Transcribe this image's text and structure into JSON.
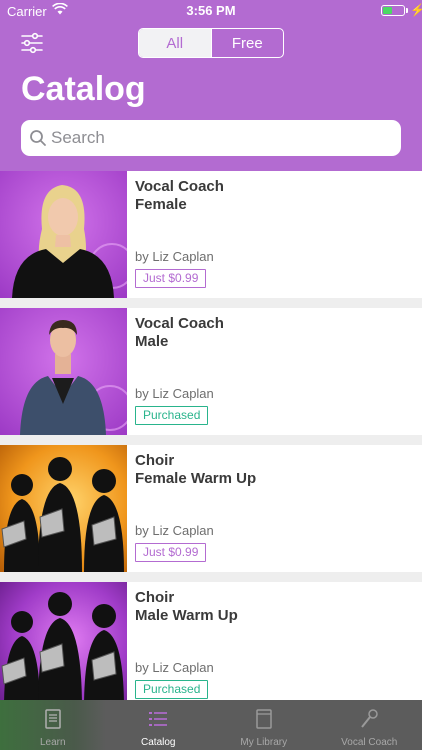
{
  "status_bar": {
    "carrier": "Carrier",
    "time": "3:56 PM",
    "battery_color": "#4cd964"
  },
  "header": {
    "filter_icon": "sliders-icon",
    "segments": [
      {
        "label": "All",
        "active": true
      },
      {
        "label": "Free",
        "active": false
      }
    ],
    "title": "Catalog",
    "search": {
      "placeholder": "Search",
      "value": ""
    },
    "accent_color": "#b36bd1"
  },
  "catalog": {
    "items": [
      {
        "title_line1": "Vocal Coach",
        "title_line2": "Female",
        "author": "by Liz Caplan",
        "badge": "Just $0.99",
        "badge_type": "price",
        "thumb": "woman-presenter"
      },
      {
        "title_line1": "Vocal Coach",
        "title_line2": "Male",
        "author": "by Liz Caplan",
        "badge": "Purchased",
        "badge_type": "purchased",
        "thumb": "man-presenter"
      },
      {
        "title_line1": "Choir",
        "title_line2": "Female Warm Up",
        "author": "by Liz Caplan",
        "badge": "Just $0.99",
        "badge_type": "price",
        "thumb": "choir-silhouettes-orange"
      },
      {
        "title_line1": "Choir",
        "title_line2": "Male Warm Up",
        "author": "by Liz Caplan",
        "badge": "Purchased",
        "badge_type": "purchased",
        "thumb": "choir-silhouettes-purple"
      }
    ]
  },
  "tabbar": {
    "tabs": [
      {
        "label": "Learn",
        "icon": "book-icon",
        "active": false
      },
      {
        "label": "Catalog",
        "icon": "list-icon",
        "active": true
      },
      {
        "label": "My Library",
        "icon": "library-icon",
        "active": false
      },
      {
        "label": "Vocal Coach",
        "icon": "microphone-icon",
        "active": false
      }
    ]
  }
}
